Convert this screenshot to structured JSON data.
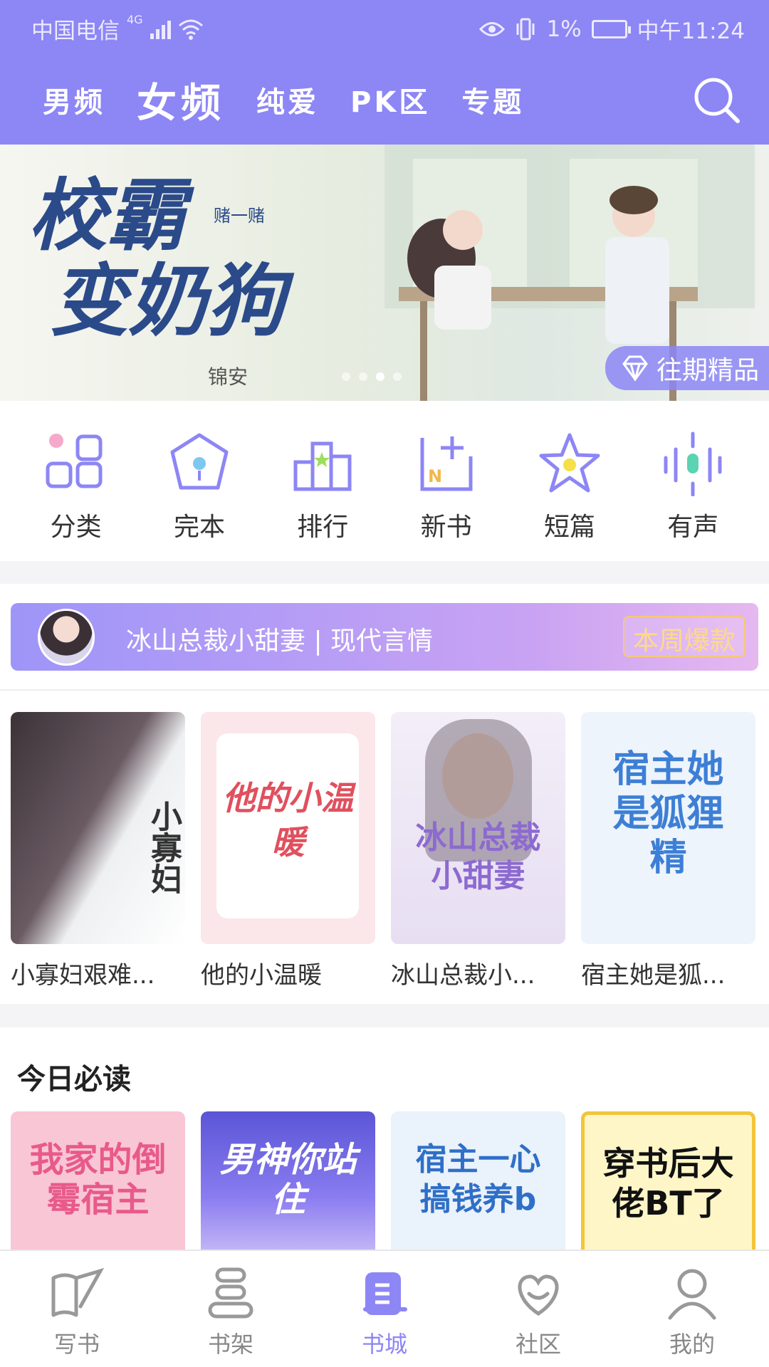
{
  "status_bar": {
    "carrier": "中国电信",
    "network": "4G",
    "battery": "1%",
    "time": "中午11:24"
  },
  "header": {
    "tabs": [
      {
        "label": "男频",
        "active": false
      },
      {
        "label": "女频",
        "active": true
      },
      {
        "label": "纯爱",
        "active": false
      },
      {
        "label": "PK区",
        "active": false
      },
      {
        "label": "专题",
        "active": false
      }
    ],
    "search_icon": "search-icon",
    "accent_color": "#8d86f5"
  },
  "banner": {
    "title_line1": "校霸",
    "title_line2": "变奶狗",
    "subtitle": "赌一赌",
    "author": "锦安",
    "badge_label": "往期精品",
    "badge_icon": "diamond-icon"
  },
  "categories": [
    {
      "label": "分类",
      "icon": "grid-icon"
    },
    {
      "label": "完本",
      "icon": "finished-icon"
    },
    {
      "label": "排行",
      "icon": "ranking-icon"
    },
    {
      "label": "新书",
      "icon": "new-book-icon"
    },
    {
      "label": "短篇",
      "icon": "star-icon"
    },
    {
      "label": "有声",
      "icon": "audio-icon"
    }
  ],
  "hot_pick": {
    "text": "冰山总裁小甜妻 | 现代言情",
    "tag": "本周爆款"
  },
  "hot_books": [
    {
      "name": "小寡妇艰难...",
      "cover_title": "小寡妇"
    },
    {
      "name": "他的小温暖",
      "cover_title": "他的小温暖"
    },
    {
      "name": "冰山总裁小...",
      "cover_title": "冰山总裁小甜妻"
    },
    {
      "name": "宿主她是狐...",
      "cover_title": "宿主她是狐狸精"
    }
  ],
  "today": {
    "heading": "今日必读",
    "books": [
      {
        "cover_title": "我家的倒霉宿主"
      },
      {
        "cover_title": "男神你站住"
      },
      {
        "cover_title": "宿主一心搞钱养b"
      },
      {
        "cover_title": "穿书后大佬BT了"
      }
    ]
  },
  "bottom_nav": [
    {
      "label": "写书",
      "icon": "write-icon",
      "active": false
    },
    {
      "label": "书架",
      "icon": "bookshelf-icon",
      "active": false
    },
    {
      "label": "书城",
      "icon": "bookstore-icon",
      "active": true
    },
    {
      "label": "社区",
      "icon": "community-icon",
      "active": false
    },
    {
      "label": "我的",
      "icon": "profile-icon",
      "active": false
    }
  ]
}
